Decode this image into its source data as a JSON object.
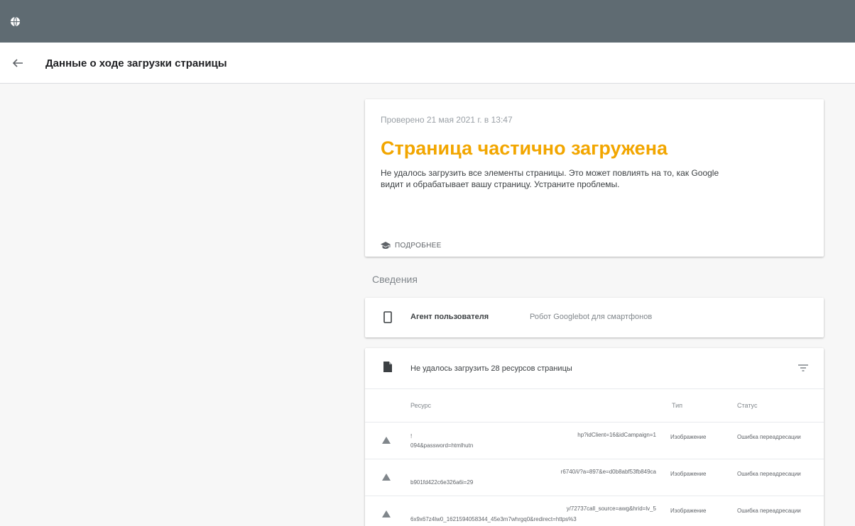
{
  "header": {
    "title": "Данные о ходе загрузки страницы"
  },
  "status_card": {
    "checked": "Проверено 21 мая 2021 г. в 13:47",
    "headline": "Страница частично загружена",
    "description": "Не удалось загрузить все элементы страницы. Это может повлиять на то, как Google видит и обрабатывает вашу страницу. Устраните проблемы.",
    "learn_more": "ПОДРОБНЕЕ",
    "headline_color": "#f2a600"
  },
  "details": {
    "section_label": "Сведения",
    "agent_key": "Агент пользователя",
    "agent_value": "Робот Googlebot для смартфонов"
  },
  "resources": {
    "title": "Не удалось загрузить 28 ресурсов страницы",
    "columns": [
      "Ресурс",
      "Тип",
      "Статус"
    ],
    "rows": [
      {
        "url_a": "!",
        "url_b": "094&password=htmlhutn",
        "url_c": "hp?idClient=16&idCampaign=1",
        "type": "Изображение",
        "status": "Ошибка переадресации"
      },
      {
        "url_a": "",
        "url_b": "b901fd422c6e326a6i=29",
        "url_c": "r6740/i/?a=897&e=d0b8abf53fb849ca",
        "type": "Изображение",
        "status": "Ошибка переадресации"
      },
      {
        "url_a": "",
        "url_b": "6x9x67z4lw0_1621594058344_45e3m7whrgq0&redirect=https%3",
        "url_c": "y/72737call_source=awg&hrid=lv_5",
        "type": "Изображение",
        "status": "Ошибка переадресации"
      }
    ]
  }
}
